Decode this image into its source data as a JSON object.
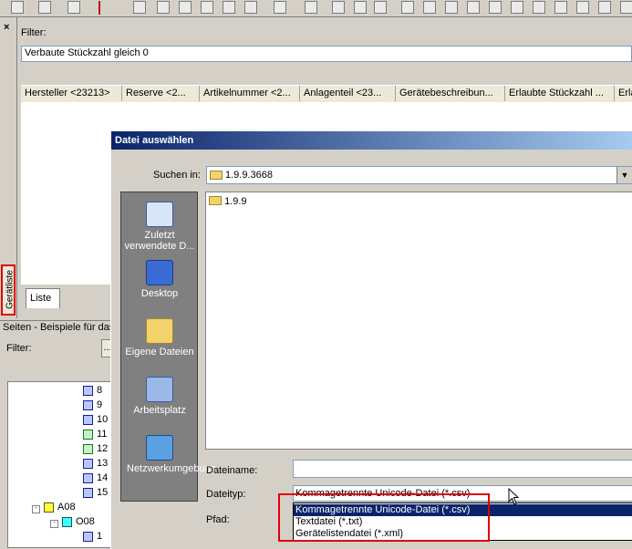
{
  "main_panel": {
    "filter_label": "Filter:",
    "filter_value": "Verbaute Stückzahl gleich 0",
    "columns": [
      "Hersteller <23213>",
      "Reserve <2...",
      "Artikelnummer <2...",
      "Anlagenteil <23...",
      "Gerätebeschreibun...",
      "Erlaubte Stückzahl ...",
      "Erla"
    ],
    "tab_label": "Liste"
  },
  "side_tab": {
    "label": "Gerätliste"
  },
  "tree_panel": {
    "title": "Seiten - Beispiele für das",
    "filter_label": "Filter:",
    "filter_button": "...",
    "items": [
      "8",
      "9",
      "10",
      "11",
      "12",
      "13",
      "14",
      "15",
      "A08",
      "O08",
      "1"
    ]
  },
  "dialog": {
    "title": "Datei auswählen",
    "look_in_label": "Suchen in:",
    "look_in_value": "1.9.9.3668",
    "places": [
      "Zuletzt verwendete D...",
      "Desktop",
      "Eigene Dateien",
      "Arbeitsplatz",
      "Netzwerkumgebung"
    ],
    "files": [
      "1.9.9"
    ],
    "filename_label": "Dateiname:",
    "filename_value": "",
    "filetype_label": "Dateityp:",
    "filetype_value": "Kommagetrennte Unicode-Datei (*.csv)",
    "path_label": "Pfad:",
    "filetype_options": [
      "Kommagetrennte Unicode-Datei (*.csv)",
      "Textdatei (*.txt)",
      "Gerätelistendatei (*.xml)"
    ]
  },
  "colors": {
    "title_bar": "#0a246a",
    "highlight": "#e00000",
    "selection": "#0a246a"
  },
  "icons": [
    "folder-icon",
    "recent-documents-icon",
    "desktop-icon",
    "my-documents-icon",
    "my-computer-icon",
    "network-icon",
    "mouse-cursor-icon"
  ]
}
